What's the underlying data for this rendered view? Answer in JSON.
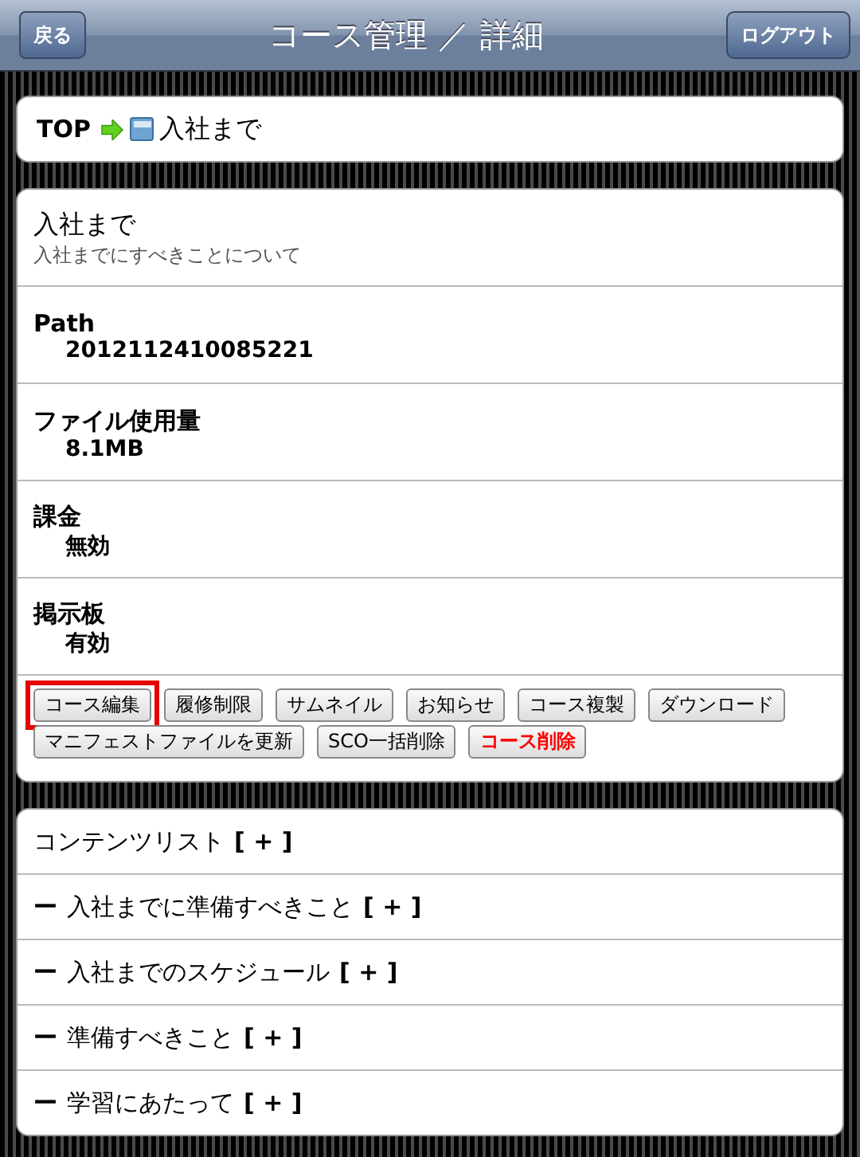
{
  "header": {
    "back_button": "戻る",
    "title": "コース管理 ／ 詳細",
    "logout_button": "ログアウト"
  },
  "breadcrumb": {
    "root": "TOP",
    "current": "入社まで"
  },
  "details": [
    {
      "kind": "title",
      "label": "入社まで",
      "value": "入社までにすべきことについて"
    },
    {
      "kind": "field",
      "label": "Path",
      "value": "2012112410085221"
    },
    {
      "kind": "field",
      "label": "ファイル使用量",
      "value": "8.1MB"
    },
    {
      "kind": "field",
      "label": "課金",
      "value": "無効"
    },
    {
      "kind": "field",
      "label": "掲示板",
      "value": "有効"
    }
  ],
  "actions": [
    {
      "label": "コース編集",
      "highlighted": true,
      "danger": false
    },
    {
      "label": "履修制限",
      "highlighted": false,
      "danger": false
    },
    {
      "label": "サムネイル",
      "highlighted": false,
      "danger": false
    },
    {
      "label": "お知らせ",
      "highlighted": false,
      "danger": false
    },
    {
      "label": "コース複製",
      "highlighted": false,
      "danger": false
    },
    {
      "label": "ダウンロード",
      "highlighted": false,
      "danger": false
    },
    {
      "label": "マニフェストファイルを更新",
      "highlighted": false,
      "danger": false
    },
    {
      "label": "SCO一括削除",
      "highlighted": false,
      "danger": false
    },
    {
      "label": "コース削除",
      "highlighted": false,
      "danger": true
    }
  ],
  "contents": {
    "title": "コンテンツリスト",
    "add": "[ + ]",
    "items": [
      {
        "bullet": "ー",
        "label": "入社までに準備すべきこと",
        "add": "[ + ]"
      },
      {
        "bullet": "ー",
        "label": "入社までのスケジュール",
        "add": "[ + ]"
      },
      {
        "bullet": "ー",
        "label": "準備すべきこと",
        "add": "[ + ]"
      },
      {
        "bullet": "ー",
        "label": "学習にあたって",
        "add": "[ + ]"
      }
    ]
  }
}
